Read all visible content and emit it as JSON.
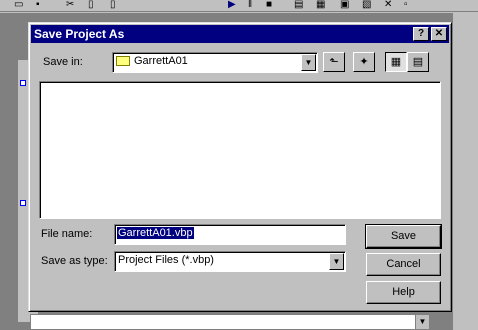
{
  "dialog": {
    "title": "Save Project As",
    "help_glyph": "?",
    "close_glyph": "✕",
    "save_in_label": "Save in:",
    "save_in_value": "GarrettA01",
    "file_name_label": "File name:",
    "file_name_value": "GarrettA01.vbp",
    "save_as_type_label": "Save as type:",
    "save_as_type_value": "Project Files (*.vbp)",
    "buttons": {
      "save": "Save",
      "cancel": "Cancel",
      "help": "Help"
    }
  },
  "toolbar": {
    "up_folder_icon": "up-folder",
    "new_folder_icon": "new-folder",
    "list_view_icon": "list-view",
    "details_view_icon": "details-view"
  }
}
